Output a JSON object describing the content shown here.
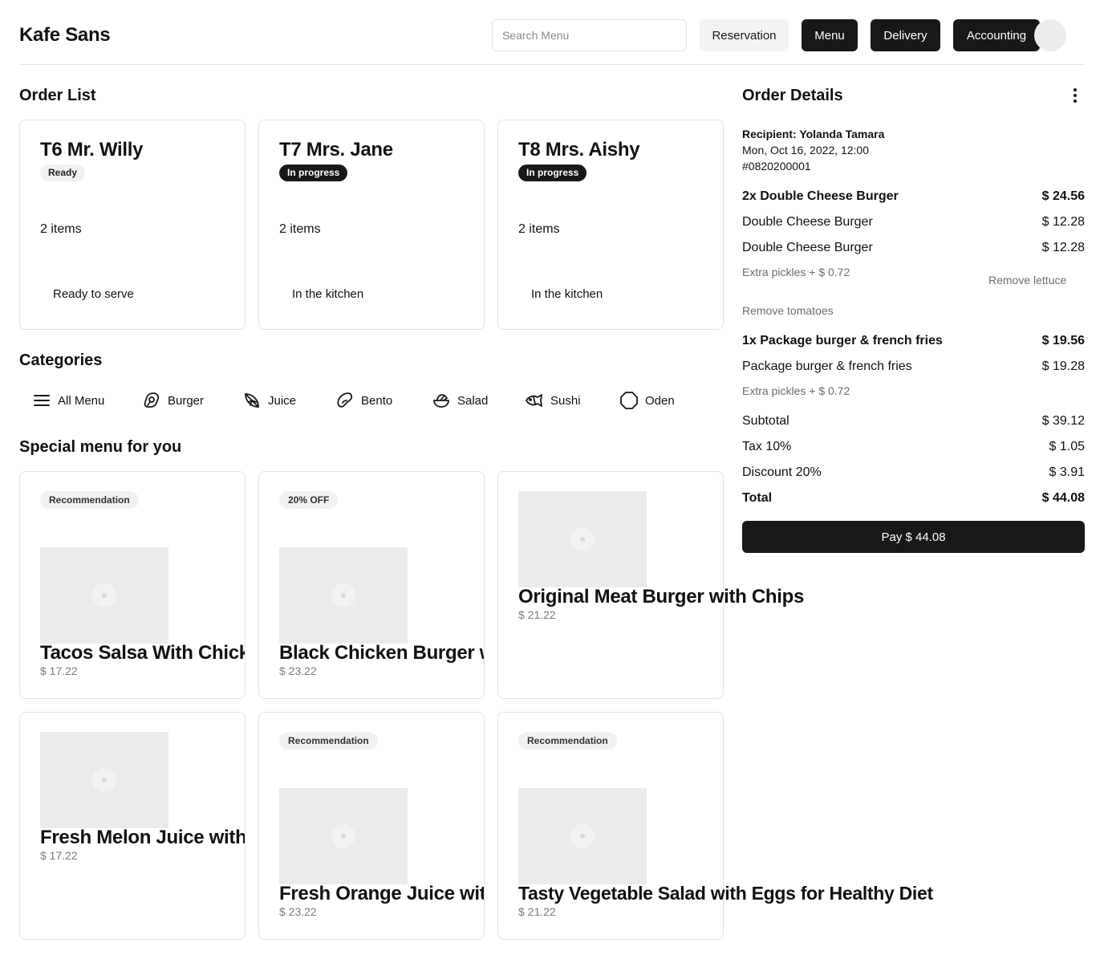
{
  "header": {
    "brand": "Kafe Sans",
    "search_placeholder": "Search Menu",
    "nav": [
      "Reservation",
      "Menu",
      "Delivery",
      "Accounting"
    ]
  },
  "order_list": {
    "title": "Order List",
    "orders": [
      {
        "name": "T6 Mr. Willy",
        "badge": "Ready",
        "items": "2 items",
        "status": "Ready to serve"
      },
      {
        "name": "T7 Mrs. Jane",
        "badge": "In progress",
        "items": "2 items",
        "status": "In the kitchen"
      },
      {
        "name": "T8 Mrs. Aishy",
        "badge": "In progress",
        "items": "2 items",
        "status": "In the kitchen"
      }
    ]
  },
  "categories": {
    "title": "Categories",
    "items": [
      {
        "label": "All Menu",
        "icon": "menu-lines-icon"
      },
      {
        "label": "Burger",
        "icon": "burger-icon"
      },
      {
        "label": "Juice",
        "icon": "citrus-icon"
      },
      {
        "label": "Bento",
        "icon": "bento-icon"
      },
      {
        "label": "Salad",
        "icon": "salad-icon"
      },
      {
        "label": "Sushi",
        "icon": "fish-icon"
      },
      {
        "label": "Oden",
        "icon": "octagon-icon"
      }
    ]
  },
  "special_menu": {
    "title": "Special menu for you",
    "items": [
      {
        "tag": "Recommendation",
        "name": "Tacos Salsa With Chicken Grilled",
        "price": "$ 17.22"
      },
      {
        "tag": "20% OFF",
        "name": "Black Chicken Burger with Cheese",
        "price": "$ 23.22"
      },
      {
        "tag": "",
        "name": "Original Meat Burger with Chips",
        "price": "$ 21.22"
      },
      {
        "tag": "",
        "name": "Fresh Melon Juice with Strawberry",
        "price": "$ 17.22"
      },
      {
        "tag": "Recommendation",
        "name": "Fresh Orange Juice with Basil Seed",
        "price": "$ 23.22"
      },
      {
        "tag": "Recommendation",
        "name": "Tasty Vegetable Salad with Eggs for Healthy Diet",
        "price": "$ 21.22"
      }
    ]
  },
  "order_details": {
    "title": "Order Details",
    "recipient": "Recipient: Yolanda Tamara",
    "datetime": "Mon, Oct 16, 2022, 12:00",
    "order_id": "#0820200001",
    "lines": [
      {
        "label": "2x Double Cheese Burger",
        "price": "$ 24.56"
      },
      {
        "label": "Double Cheese Burger",
        "price": "$ 12.28"
      },
      {
        "label": "Double Cheese Burger",
        "price": "$ 12.28"
      },
      {
        "label": "1x Package burger & french fries",
        "price": "$ 19.56"
      },
      {
        "label": "Package burger & french fries",
        "price": "$ 19.28"
      }
    ],
    "modifiers": {
      "extra_pickles_1": "Extra pickles + $ 0.72",
      "remove_lettuce": "Remove lettuce",
      "remove_tomatoes": "Remove tomatoes",
      "extra_pickles_2": "Extra pickles + $ 0.72"
    },
    "subtotal": {
      "label": "Subtotal",
      "value": "$ 39.12"
    },
    "tax": {
      "label": "Tax 10%",
      "value": "$ 1.05"
    },
    "discount": {
      "label": "Discount 20%",
      "value": "$ 3.91"
    },
    "total": {
      "label": "Total",
      "value": "$ 44.08"
    },
    "pay_label": "Pay $ 44.08"
  }
}
